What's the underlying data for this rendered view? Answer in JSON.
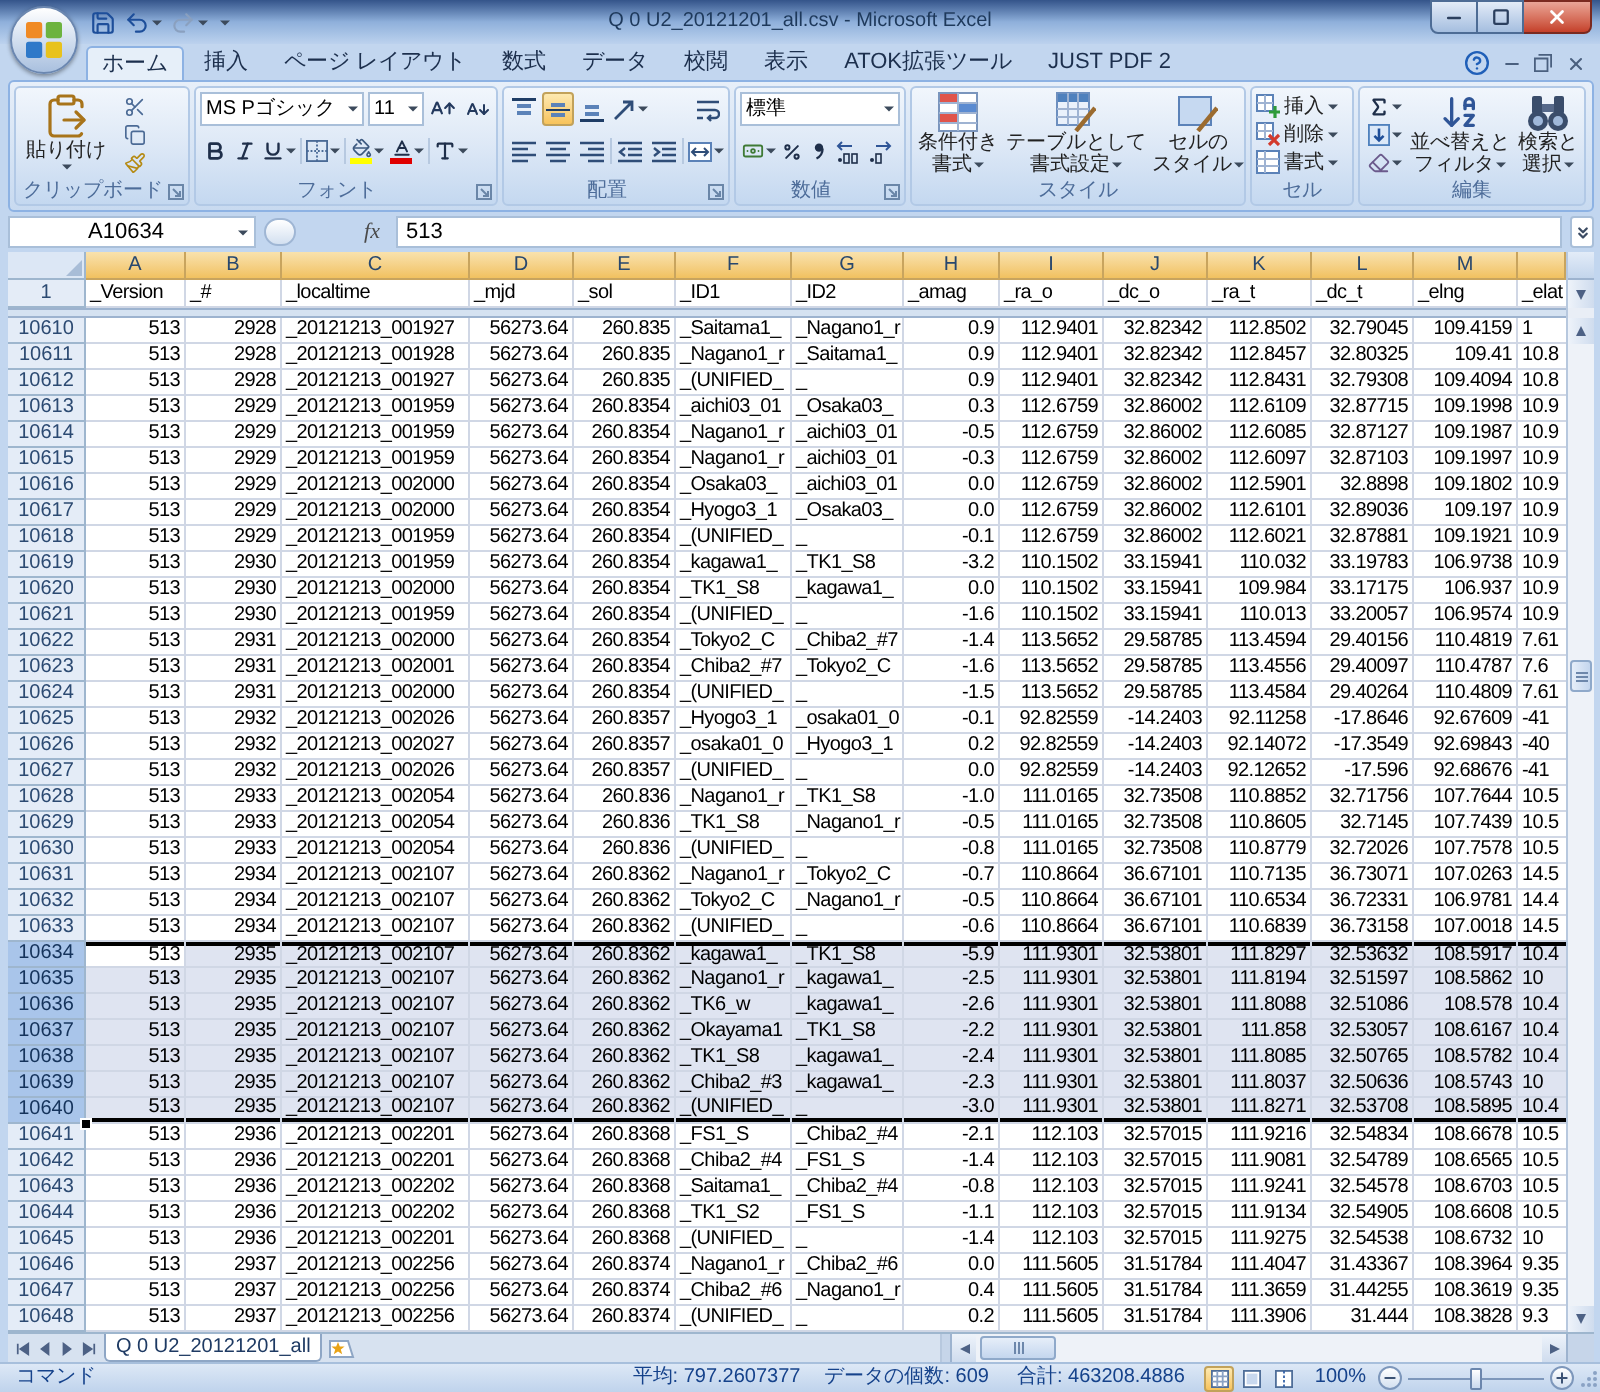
{
  "window": {
    "title": "Q 0 U2_20121201_all.csv - Microsoft Excel"
  },
  "quick_access": [
    {
      "kind": "save",
      "disabled": false
    },
    {
      "kind": "undo",
      "disabled": false
    },
    {
      "kind": "redo",
      "disabled": true
    }
  ],
  "ribbon_tabs": [
    {
      "label": "ホーム",
      "selected": true
    },
    {
      "label": "挿入",
      "selected": false
    },
    {
      "label": "ページ レイアウト",
      "selected": false
    },
    {
      "label": "数式",
      "selected": false
    },
    {
      "label": "データ",
      "selected": false
    },
    {
      "label": "校閲",
      "selected": false
    },
    {
      "label": "表示",
      "selected": false
    },
    {
      "label": "ATOK拡張ツール",
      "selected": false
    },
    {
      "label": "JUST PDF 2",
      "selected": false
    }
  ],
  "ribbon": {
    "clipboard": {
      "label": "クリップボード",
      "paste_label": "貼り付け"
    },
    "font": {
      "label": "フォント",
      "font_name": "MS Pゴシック",
      "font_size": "11"
    },
    "alignment": {
      "label": "配置",
      "vertical_align": [
        {
          "kind": "top",
          "selected": false
        },
        {
          "kind": "middle",
          "selected": true
        },
        {
          "kind": "bottom",
          "selected": false
        }
      ]
    },
    "number": {
      "label": "数値",
      "format": "標準"
    },
    "styles": {
      "label": "スタイル",
      "buttons": [
        {
          "kind": "conditional",
          "lines": [
            "条件付き",
            "書式"
          ]
        },
        {
          "kind": "table",
          "lines": [
            "テーブルとして",
            "書式設定"
          ]
        },
        {
          "kind": "cell_styles",
          "lines": [
            "セルの",
            "スタイル"
          ]
        }
      ]
    },
    "cells": {
      "label": "セル",
      "buttons": [
        {
          "kind": "insert",
          "label": "挿入"
        },
        {
          "kind": "delete",
          "label": "削除"
        },
        {
          "kind": "format",
          "label": "書式"
        }
      ]
    },
    "editing": {
      "label": "編集",
      "buttons": [
        {
          "kind": "sort_filter",
          "lines": [
            "並べ替えと",
            "フィルタ"
          ]
        },
        {
          "kind": "find_select",
          "lines": [
            "検索と",
            "選択"
          ]
        }
      ]
    }
  },
  "formula_bar": {
    "name_box": "A10634",
    "function_label": "fx",
    "value": "513"
  },
  "column_headers": [
    {
      "label": "A",
      "selected": true
    },
    {
      "label": "B",
      "selected": true
    },
    {
      "label": "C",
      "selected": true
    },
    {
      "label": "D",
      "selected": true
    },
    {
      "label": "E",
      "selected": true
    },
    {
      "label": "F",
      "selected": true
    },
    {
      "label": "G",
      "selected": true
    },
    {
      "label": "H",
      "selected": true
    },
    {
      "label": "I",
      "selected": true
    },
    {
      "label": "J",
      "selected": true
    },
    {
      "label": "K",
      "selected": true
    },
    {
      "label": "L",
      "selected": true
    },
    {
      "label": "M",
      "selected": true
    },
    {
      "selected": true
    }
  ],
  "header_row": {
    "number": "1",
    "cells": [
      "_Version",
      "_#",
      "_localtime",
      "_mjd",
      "_sol",
      "_ID1",
      "_ID2",
      "_amag",
      "_ra_o",
      "_dc_o",
      "_ra_t",
      "_dc_t",
      "_elng",
      "_elat"
    ]
  },
  "rows": [
    {
      "number": "10610",
      "selected": false,
      "cells": [
        "513",
        "2928",
        "_20121213_001927",
        "56273.64",
        "260.835",
        "_Saitama1_",
        "_Nagano1_r",
        "0.9",
        "112.9401",
        "32.82342",
        "112.8502",
        "32.79045",
        "109.4159",
        "1"
      ]
    },
    {
      "number": "10611",
      "selected": false,
      "cells": [
        "513",
        "2928",
        "_20121213_001928",
        "56273.64",
        "260.835",
        "_Nagano1_r",
        "_Saitama1_",
        "0.9",
        "112.9401",
        "32.82342",
        "112.8457",
        "32.80325",
        "109.41",
        "10.8"
      ]
    },
    {
      "number": "10612",
      "selected": false,
      "cells": [
        "513",
        "2928",
        "_20121213_001927",
        "56273.64",
        "260.835",
        "_(UNIFIED_",
        "_",
        "0.9",
        "112.9401",
        "32.82342",
        "112.8431",
        "32.79308",
        "109.4094",
        "10.8"
      ]
    },
    {
      "number": "10613",
      "selected": false,
      "cells": [
        "513",
        "2929",
        "_20121213_001959",
        "56273.64",
        "260.8354",
        "_aichi03_01",
        "_Osaka03_",
        "0.3",
        "112.6759",
        "32.86002",
        "112.6109",
        "32.87715",
        "109.1998",
        "10.9"
      ]
    },
    {
      "number": "10614",
      "selected": false,
      "cells": [
        "513",
        "2929",
        "_20121213_001959",
        "56273.64",
        "260.8354",
        "_Nagano1_r",
        "_aichi03_01",
        "-0.5",
        "112.6759",
        "32.86002",
        "112.6085",
        "32.87127",
        "109.1987",
        "10.9"
      ]
    },
    {
      "number": "10615",
      "selected": false,
      "cells": [
        "513",
        "2929",
        "_20121213_001959",
        "56273.64",
        "260.8354",
        "_Nagano1_r",
        "_aichi03_01",
        "-0.3",
        "112.6759",
        "32.86002",
        "112.6097",
        "32.87103",
        "109.1997",
        "10.9"
      ]
    },
    {
      "number": "10616",
      "selected": false,
      "cells": [
        "513",
        "2929",
        "_20121213_002000",
        "56273.64",
        "260.8354",
        "_Osaka03_",
        "_aichi03_01",
        "0.0",
        "112.6759",
        "32.86002",
        "112.5901",
        "32.8898",
        "109.1802",
        "10.9"
      ]
    },
    {
      "number": "10617",
      "selected": false,
      "cells": [
        "513",
        "2929",
        "_20121213_002000",
        "56273.64",
        "260.8354",
        "_Hyogo3_1",
        "_Osaka03_",
        "0.0",
        "112.6759",
        "32.86002",
        "112.6101",
        "32.89036",
        "109.197",
        "10.9"
      ]
    },
    {
      "number": "10618",
      "selected": false,
      "cells": [
        "513",
        "2929",
        "_20121213_001959",
        "56273.64",
        "260.8354",
        "_(UNIFIED_",
        "_",
        "-0.1",
        "112.6759",
        "32.86002",
        "112.6021",
        "32.87881",
        "109.1921",
        "10.9"
      ]
    },
    {
      "number": "10619",
      "selected": false,
      "cells": [
        "513",
        "2930",
        "_20121213_001959",
        "56273.64",
        "260.8354",
        "_kagawa1_",
        "_TK1_S8",
        "-3.2",
        "110.1502",
        "33.15941",
        "110.032",
        "33.19783",
        "106.9738",
        "10.9"
      ]
    },
    {
      "number": "10620",
      "selected": false,
      "cells": [
        "513",
        "2930",
        "_20121213_002000",
        "56273.64",
        "260.8354",
        "_TK1_S8",
        "_kagawa1_",
        "0.0",
        "110.1502",
        "33.15941",
        "109.984",
        "33.17175",
        "106.937",
        "10.9"
      ]
    },
    {
      "number": "10621",
      "selected": false,
      "cells": [
        "513",
        "2930",
        "_20121213_001959",
        "56273.64",
        "260.8354",
        "_(UNIFIED_",
        "_",
        "-1.6",
        "110.1502",
        "33.15941",
        "110.013",
        "33.20057",
        "106.9574",
        "10.9"
      ]
    },
    {
      "number": "10622",
      "selected": false,
      "cells": [
        "513",
        "2931",
        "_20121213_002000",
        "56273.64",
        "260.8354",
        "_Tokyo2_C",
        "_Chiba2_#7",
        "-1.4",
        "113.5652",
        "29.58785",
        "113.4594",
        "29.40156",
        "110.4819",
        "7.61"
      ]
    },
    {
      "number": "10623",
      "selected": false,
      "cells": [
        "513",
        "2931",
        "_20121213_002001",
        "56273.64",
        "260.8354",
        "_Chiba2_#7",
        "_Tokyo2_C",
        "-1.6",
        "113.5652",
        "29.58785",
        "113.4556",
        "29.40097",
        "110.4787",
        "7.6"
      ]
    },
    {
      "number": "10624",
      "selected": false,
      "cells": [
        "513",
        "2931",
        "_20121213_002000",
        "56273.64",
        "260.8354",
        "_(UNIFIED_",
        "_",
        "-1.5",
        "113.5652",
        "29.58785",
        "113.4584",
        "29.40264",
        "110.4809",
        "7.61"
      ]
    },
    {
      "number": "10625",
      "selected": false,
      "cells": [
        "513",
        "2932",
        "_20121213_002026",
        "56273.64",
        "260.8357",
        "_Hyogo3_1",
        "_osaka01_0",
        "-0.1",
        "92.82559",
        "-14.2403",
        "92.11258",
        "-17.8646",
        "92.67609",
        "-41"
      ]
    },
    {
      "number": "10626",
      "selected": false,
      "cells": [
        "513",
        "2932",
        "_20121213_002027",
        "56273.64",
        "260.8357",
        "_osaka01_0",
        "_Hyogo3_1",
        "0.2",
        "92.82559",
        "-14.2403",
        "92.14072",
        "-17.3549",
        "92.69843",
        "-40"
      ]
    },
    {
      "number": "10627",
      "selected": false,
      "cells": [
        "513",
        "2932",
        "_20121213_002026",
        "56273.64",
        "260.8357",
        "_(UNIFIED_",
        "_",
        "0.0",
        "92.82559",
        "-14.2403",
        "92.12652",
        "-17.596",
        "92.68676",
        "-41"
      ]
    },
    {
      "number": "10628",
      "selected": false,
      "cells": [
        "513",
        "2933",
        "_20121213_002054",
        "56273.64",
        "260.836",
        "_Nagano1_r",
        "_TK1_S8",
        "-1.0",
        "111.0165",
        "32.73508",
        "110.8852",
        "32.71756",
        "107.7644",
        "10.5"
      ]
    },
    {
      "number": "10629",
      "selected": false,
      "cells": [
        "513",
        "2933",
        "_20121213_002054",
        "56273.64",
        "260.836",
        "_TK1_S8",
        "_Nagano1_r",
        "-0.5",
        "111.0165",
        "32.73508",
        "110.8605",
        "32.7145",
        "107.7439",
        "10.5"
      ]
    },
    {
      "number": "10630",
      "selected": false,
      "cells": [
        "513",
        "2933",
        "_20121213_002054",
        "56273.64",
        "260.836",
        "_(UNIFIED_",
        "_",
        "-0.8",
        "111.0165",
        "32.73508",
        "110.8779",
        "32.72026",
        "107.7578",
        "10.5"
      ]
    },
    {
      "number": "10631",
      "selected": false,
      "cells": [
        "513",
        "2934",
        "_20121213_002107",
        "56273.64",
        "260.8362",
        "_Nagano1_r",
        "_Tokyo2_C",
        "-0.7",
        "110.8664",
        "36.67101",
        "110.7135",
        "36.73071",
        "107.0263",
        "14.5"
      ]
    },
    {
      "number": "10632",
      "selected": false,
      "cells": [
        "513",
        "2934",
        "_20121213_002107",
        "56273.64",
        "260.8362",
        "_Tokyo2_C",
        "_Nagano1_r",
        "-0.5",
        "110.8664",
        "36.67101",
        "110.6534",
        "36.72331",
        "106.9781",
        "14.4"
      ]
    },
    {
      "number": "10633",
      "selected": false,
      "cells": [
        "513",
        "2934",
        "_20121213_002107",
        "56273.64",
        "260.8362",
        "_(UNIFIED_",
        "_",
        "-0.6",
        "110.8664",
        "36.67101",
        "110.6839",
        "36.73158",
        "107.0018",
        "14.5"
      ]
    },
    {
      "number": "10634",
      "selected": true,
      "cells": [
        "513",
        "2935",
        "_20121213_002107",
        "56273.64",
        "260.8362",
        "_kagawa1_",
        "_TK1_S8",
        "-5.9",
        "111.9301",
        "32.53801",
        "111.8297",
        "32.53632",
        "108.5917",
        "10.4"
      ]
    },
    {
      "number": "10635",
      "selected": true,
      "cells": [
        "513",
        "2935",
        "_20121213_002107",
        "56273.64",
        "260.8362",
        "_Nagano1_r",
        "_kagawa1_",
        "-2.5",
        "111.9301",
        "32.53801",
        "111.8194",
        "32.51597",
        "108.5862",
        "10"
      ]
    },
    {
      "number": "10636",
      "selected": true,
      "cells": [
        "513",
        "2935",
        "_20121213_002107",
        "56273.64",
        "260.8362",
        "_TK6_w",
        "_kagawa1_",
        "-2.6",
        "111.9301",
        "32.53801",
        "111.8088",
        "32.51086",
        "108.578",
        "10.4"
      ]
    },
    {
      "number": "10637",
      "selected": true,
      "cells": [
        "513",
        "2935",
        "_20121213_002107",
        "56273.64",
        "260.8362",
        "_Okayama1",
        "_TK1_S8",
        "-2.2",
        "111.9301",
        "32.53801",
        "111.858",
        "32.53057",
        "108.6167",
        "10.4"
      ]
    },
    {
      "number": "10638",
      "selected": true,
      "cells": [
        "513",
        "2935",
        "_20121213_002107",
        "56273.64",
        "260.8362",
        "_TK1_S8",
        "_kagawa1_",
        "-2.4",
        "111.9301",
        "32.53801",
        "111.8085",
        "32.50765",
        "108.5782",
        "10.4"
      ]
    },
    {
      "number": "10639",
      "selected": true,
      "cells": [
        "513",
        "2935",
        "_20121213_002107",
        "56273.64",
        "260.8362",
        "_Chiba2_#3",
        "_kagawa1_",
        "-2.3",
        "111.9301",
        "32.53801",
        "111.8037",
        "32.50636",
        "108.5743",
        "10"
      ]
    },
    {
      "number": "10640",
      "selected": true,
      "cells": [
        "513",
        "2935",
        "_20121213_002107",
        "56273.64",
        "260.8362",
        "_(UNIFIED_",
        "_",
        "-3.0",
        "111.9301",
        "32.53801",
        "111.8271",
        "32.53708",
        "108.5895",
        "10.4"
      ]
    },
    {
      "number": "10641",
      "selected": false,
      "cells": [
        "513",
        "2936",
        "_20121213_002201",
        "56273.64",
        "260.8368",
        "_FS1_S",
        "_Chiba2_#4",
        "-2.1",
        "112.103",
        "32.57015",
        "111.9216",
        "32.54834",
        "108.6678",
        "10.5"
      ]
    },
    {
      "number": "10642",
      "selected": false,
      "cells": [
        "513",
        "2936",
        "_20121213_002201",
        "56273.64",
        "260.8368",
        "_Chiba2_#4",
        "_FS1_S",
        "-1.4",
        "112.103",
        "32.57015",
        "111.9081",
        "32.54789",
        "108.6565",
        "10.5"
      ]
    },
    {
      "number": "10643",
      "selected": false,
      "cells": [
        "513",
        "2936",
        "_20121213_002202",
        "56273.64",
        "260.8368",
        "_Saitama1_",
        "_Chiba2_#4",
        "-0.8",
        "112.103",
        "32.57015",
        "111.9241",
        "32.54578",
        "108.6703",
        "10.5"
      ]
    },
    {
      "number": "10644",
      "selected": false,
      "cells": [
        "513",
        "2936",
        "_20121213_002202",
        "56273.64",
        "260.8368",
        "_TK1_S2",
        "_FS1_S",
        "-1.1",
        "112.103",
        "32.57015",
        "111.9134",
        "32.54905",
        "108.6608",
        "10.5"
      ]
    },
    {
      "number": "10645",
      "selected": false,
      "cells": [
        "513",
        "2936",
        "_20121213_002201",
        "56273.64",
        "260.8368",
        "_(UNIFIED_",
        "_",
        "-1.4",
        "112.103",
        "32.57015",
        "111.9275",
        "32.54538",
        "108.6732",
        "10"
      ]
    },
    {
      "number": "10646",
      "selected": false,
      "cells": [
        "513",
        "2937",
        "_20121213_002256",
        "56273.64",
        "260.8374",
        "_Nagano1_r",
        "_Chiba2_#6",
        "0.0",
        "111.5605",
        "31.51784",
        "111.4047",
        "31.43367",
        "108.3964",
        "9.35"
      ]
    },
    {
      "number": "10647",
      "selected": false,
      "cells": [
        "513",
        "2937",
        "_20121213_002256",
        "56273.64",
        "260.8374",
        "_Chiba2_#6",
        "_Nagano1_r",
        "0.4",
        "111.5605",
        "31.51784",
        "111.3659",
        "31.44255",
        "108.3619",
        "9.35"
      ]
    },
    {
      "number": "10648",
      "selected": false,
      "cells": [
        "513",
        "2937",
        "_20121213_002256",
        "56273.64",
        "260.8374",
        "_(UNIFIED_",
        "_",
        "0.2",
        "111.5605",
        "31.51784",
        "111.3906",
        "31.444",
        "108.3828",
        "9.3"
      ]
    }
  ],
  "sheet_tabs": [
    {
      "label": "Q 0 U2_20121201_all",
      "selected": true
    }
  ],
  "status_bar": {
    "mode": "コマンド",
    "average": "平均: 797.2607377",
    "count": "データの個数: 609",
    "sum": "合計: 463208.4886",
    "view_buttons": [
      {
        "kind": "normal",
        "selected": true
      },
      {
        "kind": "page_layout",
        "selected": false
      },
      {
        "kind": "page_break",
        "selected": false
      }
    ],
    "zoom": "100%",
    "zoom_slider": {
      "level": 0.5
    }
  }
}
